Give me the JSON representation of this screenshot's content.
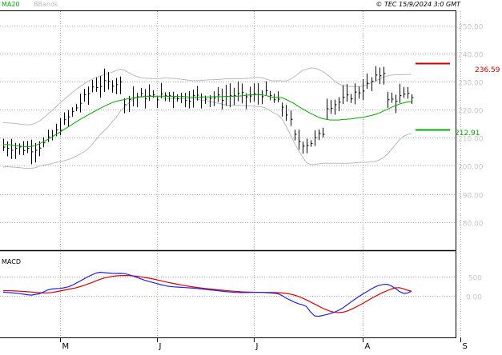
{
  "header": {
    "indicator_labels": [
      "MA20",
      "BBands"
    ],
    "timestamp": "© TEC 15/9/2024 3:0 GMT"
  },
  "colors": {
    "ma20": "#00aa00",
    "bbands": "#bbbbbb",
    "price": "#000000",
    "macd": "#2222ee",
    "signal": "#dd0000",
    "resistance": "#cc0000",
    "support": "#00aa00",
    "grid": "#b0b0b0",
    "frame": "#000000",
    "axis_text": "#c8c8c8",
    "macd_label": "#000000"
  },
  "levels": {
    "resistance": {
      "value": 236.59,
      "label": "236.59"
    },
    "support": {
      "value": 212.91,
      "label": "212.91"
    }
  },
  "chart_data": [
    {
      "type": "line",
      "panel": "price",
      "series": [
        {
          "name": "MA20",
          "values": [
            207.5,
            207.6,
            207.4,
            207.2,
            207.1,
            206.9,
            206.8,
            206.9,
            207.3,
            207.9,
            208.6,
            209.4,
            210.2,
            211.1,
            212.0,
            212.9,
            213.8,
            214.7,
            215.6,
            216.5,
            217.3,
            218.1,
            218.9,
            219.7,
            220.5,
            221.2,
            221.9,
            222.5,
            223.0,
            223.3,
            223.6,
            223.9,
            224.1,
            224.3,
            224.5,
            224.6,
            224.7,
            224.8,
            224.8,
            224.8,
            224.8,
            224.7,
            224.7,
            224.7,
            224.6,
            224.6,
            224.5,
            224.4,
            224.4,
            224.5,
            224.5,
            224.5,
            224.6,
            224.6,
            224.6,
            224.7,
            224.7,
            224.8,
            224.8,
            224.9,
            225.1,
            225.2,
            225.3,
            225.4,
            225.3,
            225.0,
            224.6,
            224.3,
            224.4,
            224.2,
            223.6,
            222.9,
            222.1,
            221.2,
            220.3,
            219.5,
            218.7,
            218.0,
            217.3,
            216.8,
            216.5,
            216.3,
            216.3,
            216.3,
            216.5,
            216.6,
            216.7,
            216.9,
            217.1,
            217.3,
            217.6,
            217.9,
            218.3,
            218.8,
            219.5,
            220.1,
            220.8,
            221.4,
            222.0,
            222.4,
            222.7,
            222.8
          ]
        },
        {
          "name": "BB Upper",
          "values": [
            215.4,
            215.3,
            215.2,
            215.1,
            214.9,
            214.7,
            214.6,
            214.7,
            215.2,
            216.0,
            217.1,
            218.3,
            219.6,
            220.9,
            222.3,
            223.5,
            224.8,
            226.0,
            227.1,
            228.2,
            229.2,
            230.1,
            230.8,
            231.4,
            232.0,
            232.4,
            232.9,
            233.3,
            233.9,
            234.4,
            234.0,
            233.2,
            232.4,
            231.8,
            231.4,
            231.2,
            231.1,
            231.0,
            231.0,
            231.1,
            231.3,
            231.2,
            231.1,
            231.0,
            230.8,
            230.6,
            230.4,
            230.3,
            230.3,
            230.4,
            230.5,
            230.6,
            230.6,
            230.7,
            230.8,
            231.0,
            231.0,
            231.0,
            231.0,
            231.0,
            231.1,
            231.2,
            231.4,
            231.5,
            231.4,
            230.9,
            230.4,
            230.2,
            230.3,
            230.2,
            230.2,
            230.8,
            231.7,
            232.8,
            233.9,
            234.4,
            234.8,
            234.8,
            234.3,
            233.6,
            232.6,
            231.5,
            230.1,
            229.2,
            228.6,
            228.3,
            228.2,
            228.2,
            228.2,
            228.4,
            228.9,
            229.5,
            230.1,
            230.8,
            231.5,
            232.0,
            232.3,
            232.4,
            232.4,
            232.4,
            232.5,
            232.5
          ]
        },
        {
          "name": "BB Lower",
          "values": [
            199.6,
            199.7,
            199.6,
            199.5,
            199.4,
            199.2,
            199.1,
            199.1,
            199.4,
            199.9,
            200.3,
            200.5,
            200.8,
            201.2,
            201.5,
            201.8,
            202.2,
            202.7,
            203.4,
            204.2,
            205.0,
            206.1,
            207.6,
            209.4,
            211.2,
            212.5,
            214.0,
            215.8,
            217.4,
            219.5,
            220.8,
            222.3,
            223.6,
            224.3,
            224.7,
            224.9,
            224.8,
            224.6,
            224.5,
            224.3,
            224.0,
            223.9,
            223.9,
            223.9,
            223.9,
            223.9,
            223.9,
            223.8,
            223.7,
            223.4,
            223.2,
            222.9,
            222.6,
            222.3,
            222.0,
            221.7,
            221.5,
            221.5,
            221.5,
            221.5,
            221.4,
            221.3,
            221.2,
            221.1,
            221.0,
            220.5,
            219.6,
            218.8,
            218.1,
            216.6,
            214.0,
            211.2,
            208.3,
            205.6,
            203.3,
            201.2,
            200.5,
            200.5,
            200.7,
            200.9,
            200.9,
            200.9,
            200.9,
            200.9,
            200.9,
            200.9,
            201.0,
            201.1,
            201.2,
            201.3,
            201.3,
            201.4,
            201.6,
            202.1,
            202.9,
            204.1,
            205.8,
            207.5,
            209.2,
            210.5,
            211.2,
            211.5
          ]
        }
      ]
    },
    {
      "type": "line",
      "panel": "macd",
      "series": [
        {
          "name": "MACD",
          "values": [
            102,
            95,
            88,
            78,
            66,
            52,
            38,
            28,
            48,
            62,
            112,
            158,
            182,
            192,
            198,
            212,
            238,
            275,
            330,
            386,
            442,
            498,
            546,
            590,
            610,
            600,
            590,
            582,
            580,
            582,
            575,
            552,
            520,
            482,
            444,
            408,
            378,
            350,
            320,
            294,
            270,
            251,
            240,
            233,
            226,
            219,
            212,
            205,
            196,
            185,
            174,
            163,
            152,
            141,
            130,
            119,
            108,
            100,
            94,
            92,
            92,
            95,
            97,
            98,
            96,
            90,
            82,
            74,
            62,
            16,
            -52,
            -98,
            -150,
            -190,
            -218,
            -262,
            -400,
            -500,
            -512,
            -492,
            -468,
            -440,
            -405,
            -358,
            -300,
            -226,
            -150,
            -78,
            -8,
            60,
            120,
            182,
            238,
            278,
            298,
            302,
            262,
            198,
            120,
            72,
            80,
            130
          ]
        },
        {
          "name": "Signal",
          "values": [
            142,
            140,
            137,
            133,
            128,
            121,
            113,
            105,
            97,
            89,
            82,
            84,
            95,
            112,
            132,
            152,
            172,
            192,
            215,
            243,
            275,
            312,
            350,
            392,
            430,
            462,
            486,
            505,
            518,
            524,
            526,
            524,
            518,
            508,
            495,
            478,
            460,
            440,
            418,
            395,
            370,
            348,
            327,
            307,
            288,
            270,
            252,
            236,
            222,
            209,
            197,
            186,
            175,
            165,
            155,
            145,
            136,
            127,
            119,
            112,
            107,
            103,
            100,
            98,
            97,
            96,
            95,
            93,
            89,
            82,
            71,
            55,
            30,
            -5,
            -48,
            -95,
            -145,
            -198,
            -252,
            -306,
            -350,
            -388,
            -412,
            -418,
            -408,
            -382,
            -340,
            -290,
            -236,
            -182,
            -122,
            -60,
            -4,
            48,
            98,
            142,
            182,
            212,
            218,
            188,
            152,
            128
          ]
        }
      ]
    }
  ],
  "price_panel": {
    "y_ticks": [
      {
        "value": 250,
        "label": "250.00"
      },
      {
        "value": 240,
        "label": "240.00"
      },
      {
        "value": 230,
        "label": "230.00"
      },
      {
        "value": 220,
        "label": "220.00"
      },
      {
        "value": 210,
        "label": "210.00"
      },
      {
        "value": 200,
        "label": "200.00"
      },
      {
        "value": 190,
        "label": "190.00"
      },
      {
        "value": 180,
        "label": "180.00"
      }
    ],
    "ylim": [
      170,
      255
    ]
  },
  "macd_panel": {
    "label": "MACD",
    "y_ticks": [
      {
        "value": 500,
        "label": "500"
      },
      {
        "value": 0,
        "label": "0.00"
      }
    ],
    "ylim": [
      -1050,
      1150
    ]
  },
  "x_axis": {
    "month_ticks": [
      {
        "index": 14,
        "label": "M"
      },
      {
        "index": 38,
        "label": "J"
      },
      {
        "index": 62,
        "label": "J"
      },
      {
        "index": 89,
        "label": "A"
      },
      {
        "index": 113,
        "label": "S"
      }
    ]
  }
}
